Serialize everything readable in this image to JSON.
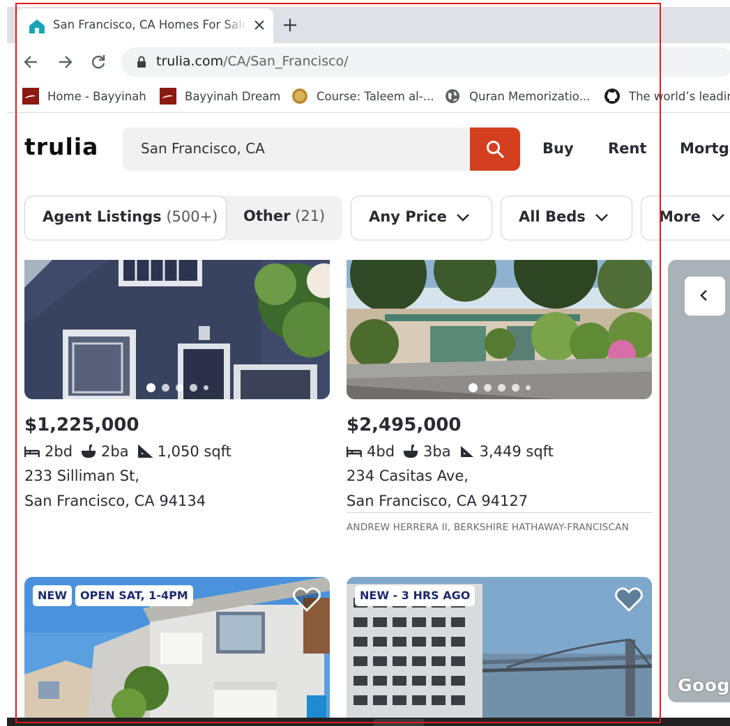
{
  "browser": {
    "tab_title": "San Francisco, CA Homes For Sale",
    "url_host": "trulia.com",
    "url_path": "/CA/San_Francisco/",
    "bookmarks": [
      {
        "label": "Home - Bayyinah",
        "icon": "bayyinah-icon"
      },
      {
        "label": "Bayyinah Dream",
        "icon": "bayyinah-icon"
      },
      {
        "label": "Course: Taleem al-...",
        "icon": "coin-icon"
      },
      {
        "label": "Quran Memorizatio...",
        "icon": "globe-icon"
      },
      {
        "label": "The world’s leading",
        "icon": "github-icon"
      }
    ]
  },
  "header": {
    "logo": "trulia",
    "search_value": "San Francisco, CA",
    "nav": [
      "Buy",
      "Rent",
      "Mortgage"
    ]
  },
  "filters": {
    "agent_listings": "Agent Listings",
    "agent_count": "(500+)",
    "other": "Other",
    "other_count": "(21)",
    "price": "Any Price",
    "beds": "All Beds",
    "more": "More"
  },
  "listings": [
    {
      "price": "$1,225,000",
      "beds": "2bd",
      "baths": "2ba",
      "sqft": "1,050 sqft",
      "address_line1": "233 Silliman St,",
      "address_line2": "San Francisco, CA 94134",
      "photo_count_dots": 5,
      "active_photo": 0
    },
    {
      "price": "$2,495,000",
      "beds": "4bd",
      "baths": "3ba",
      "sqft": "3,449 sqft",
      "address_line1": "234 Casitas Ave,",
      "address_line2": "San Francisco, CA 94127",
      "agent": "ANDREW HERRERA II, BERKSHIRE HATHAWAY-FRANCISCAN",
      "photo_count_dots": 5,
      "active_photo": 0
    },
    {
      "badges": [
        "NEW",
        "OPEN SAT, 1-4PM"
      ]
    },
    {
      "badges": [
        "NEW - 3 HRS AGO"
      ]
    }
  ],
  "map": {
    "attribution": "Google"
  },
  "colors": {
    "accent": "#d43f1f",
    "badge_text": "#1e2a6b",
    "text": "#2a2a33"
  }
}
